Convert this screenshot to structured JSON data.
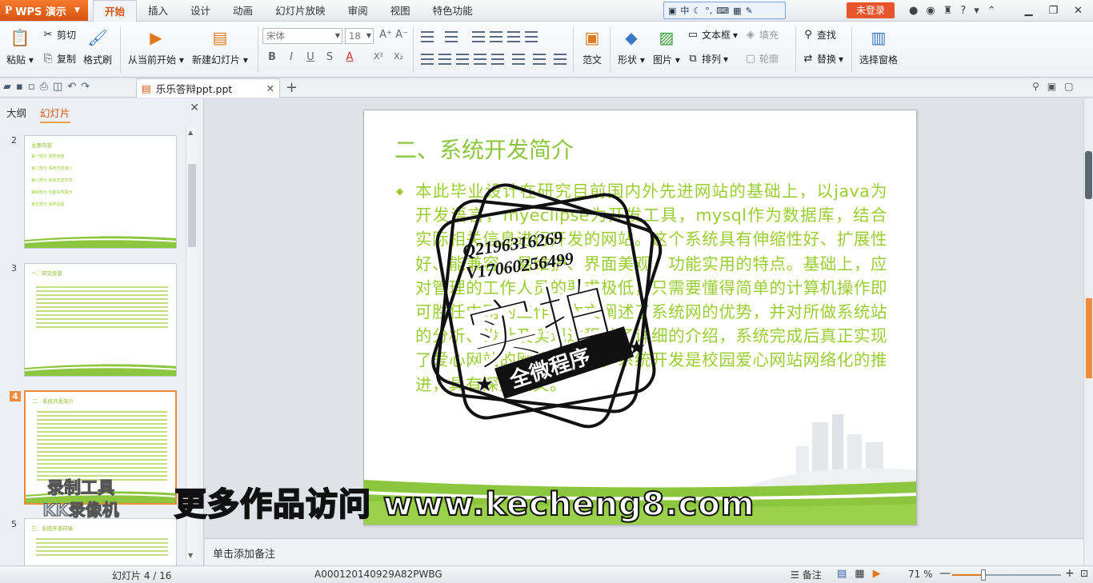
{
  "app": {
    "name": "WPS 演示",
    "logo_letter": "P",
    "login_label": "未登录"
  },
  "menu": {
    "tabs": [
      "开始",
      "插入",
      "设计",
      "动画",
      "幻灯片放映",
      "审阅",
      "视图",
      "特色功能"
    ],
    "active": "开始"
  },
  "ime": {
    "mode": "中"
  },
  "ribbon": {
    "paste": "粘贴",
    "cut": "剪切",
    "copy": "复制",
    "format_painter": "格式刷",
    "from_current": "从当前开始",
    "new_slide": "新建幻灯片",
    "font_name": "宋体",
    "font_size": "18",
    "template": "范文",
    "shape": "形状",
    "picture": "图片",
    "textbox": "文本框",
    "fill": "填充",
    "arrange": "排列",
    "outline": "轮廓",
    "find": "查找",
    "replace": "替换",
    "selection_pane": "选择窗格"
  },
  "document": {
    "tab_name": "乐乐答辩ppt.ppt"
  },
  "left_pane": {
    "tab_outline": "大纲",
    "tab_slides": "幻灯片",
    "active_tab": "幻灯片",
    "thumbnails": [
      {
        "number": "2",
        "title": "主要内容",
        "bullets": [
          "第一部分  研究背景",
          "第二部分  系统开发简介",
          "第三部分  系统开发环境",
          "第四部分  功能实现展示",
          "第五部分  系统总结"
        ]
      },
      {
        "number": "3",
        "title": "一、研究背景"
      },
      {
        "number": "4",
        "title": "二、系统开发简介"
      },
      {
        "number": "5",
        "title": "三、系统开发环境"
      }
    ],
    "selected": "4"
  },
  "slide": {
    "title": "二、系统开发简介",
    "body": "本此毕业设计在研究目前国内外先进网站的基础上，以java为开发语言，myeclipse为开发工具，mysql作为数据库，结合实际相关信息进行开发的网站。这个系统具有伸缩性好、扩展性好、能兼容、易维护、界面美观，功能实用的特点。基础上，应对管理的工作人员的要求极低，只需要懂得简单的计算机操作即可胜任中网的工作。本文阐述了系统网的优势，并对所做系统站的分析、设计及实现过程做了详细的介绍，系统完成后真正实现了爱心网站的网络化管理，系统开发是校园爱心网站网络化的推进，具有深远意义。"
  },
  "notes": {
    "placeholder": "单击添加备注"
  },
  "watermark": {
    "line1": "Q2196316269",
    "line2": "V17060256499",
    "big": "实拍",
    "ribbon": "全微程序"
  },
  "overlays": {
    "banner": "更多作品访问 www.kecheng8.com",
    "rec_line1": "录制工具",
    "rec_line2": "KK录像机"
  },
  "status": {
    "slide_indicator": "幻灯片 4 / 16",
    "doc_id": "A000120140929A82PWBG",
    "notes_label": "备注",
    "zoom": "71 %",
    "zoom_value": 71
  }
}
